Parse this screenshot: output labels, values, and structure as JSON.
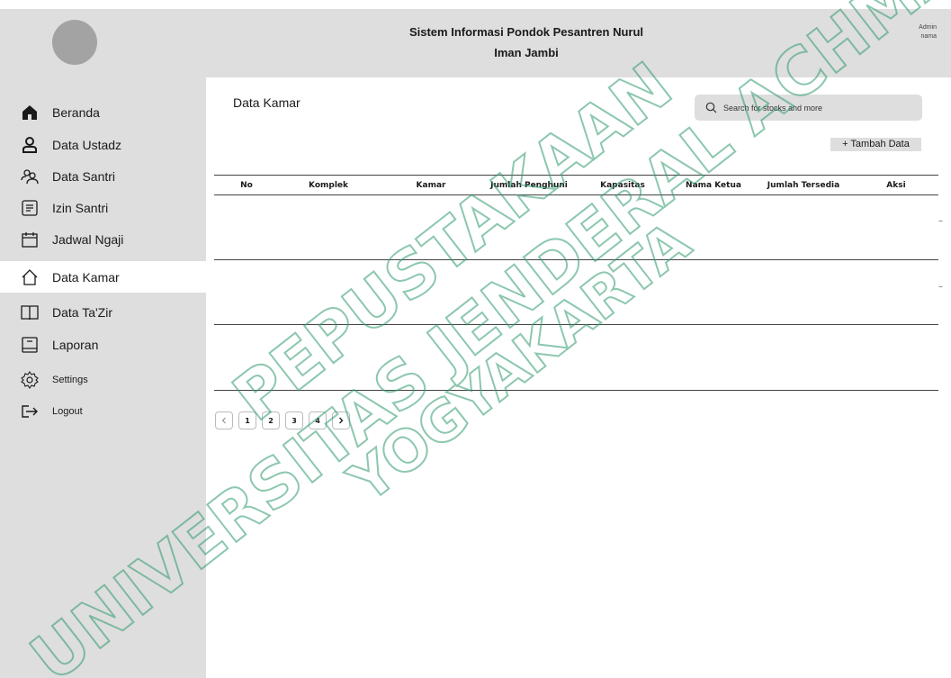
{
  "header": {
    "title_line1": "Sistem Informasi Pondok Pesantren Nurul",
    "title_line2": "Iman Jambi",
    "user_role": "Admin",
    "user_name": "nama"
  },
  "sidebar": {
    "items": [
      {
        "label": "Beranda",
        "icon": "home-icon"
      },
      {
        "label": "Data Ustadz",
        "icon": "user-icon"
      },
      {
        "label": "Data Santri",
        "icon": "users-icon"
      },
      {
        "label": "Izin Santri",
        "icon": "document-icon"
      },
      {
        "label": "Jadwal Ngaji",
        "icon": "calendar-icon"
      },
      {
        "label": "Data Kamar",
        "icon": "house-outline-icon",
        "active": true
      },
      {
        "label": "Data Ta'Zir",
        "icon": "book-icon"
      },
      {
        "label": "Laporan",
        "icon": "report-icon"
      },
      {
        "label": "Settings",
        "icon": "gear-icon"
      },
      {
        "label": "Logout",
        "icon": "logout-icon"
      }
    ]
  },
  "main": {
    "page_title": "Data Kamar",
    "search_placeholder": "Search for stocks and more",
    "add_button": "+ Tambah Data"
  },
  "table": {
    "columns": [
      "No",
      "Komplek",
      "Kamar",
      "Jumlah Penghuni",
      "Kapasitas",
      "Nama Ketua",
      "Jumlah Tersedia",
      "Aksi"
    ],
    "rows": [
      [],
      [],
      []
    ]
  },
  "pagination": {
    "pages": [
      "1",
      "2",
      "3",
      "4"
    ]
  },
  "watermark": {
    "line1": "PEPUSTAKAAN",
    "line2": "UNIVERSITAS JENDERAL ACHMAD",
    "line3": "YOGYAKARTA"
  }
}
